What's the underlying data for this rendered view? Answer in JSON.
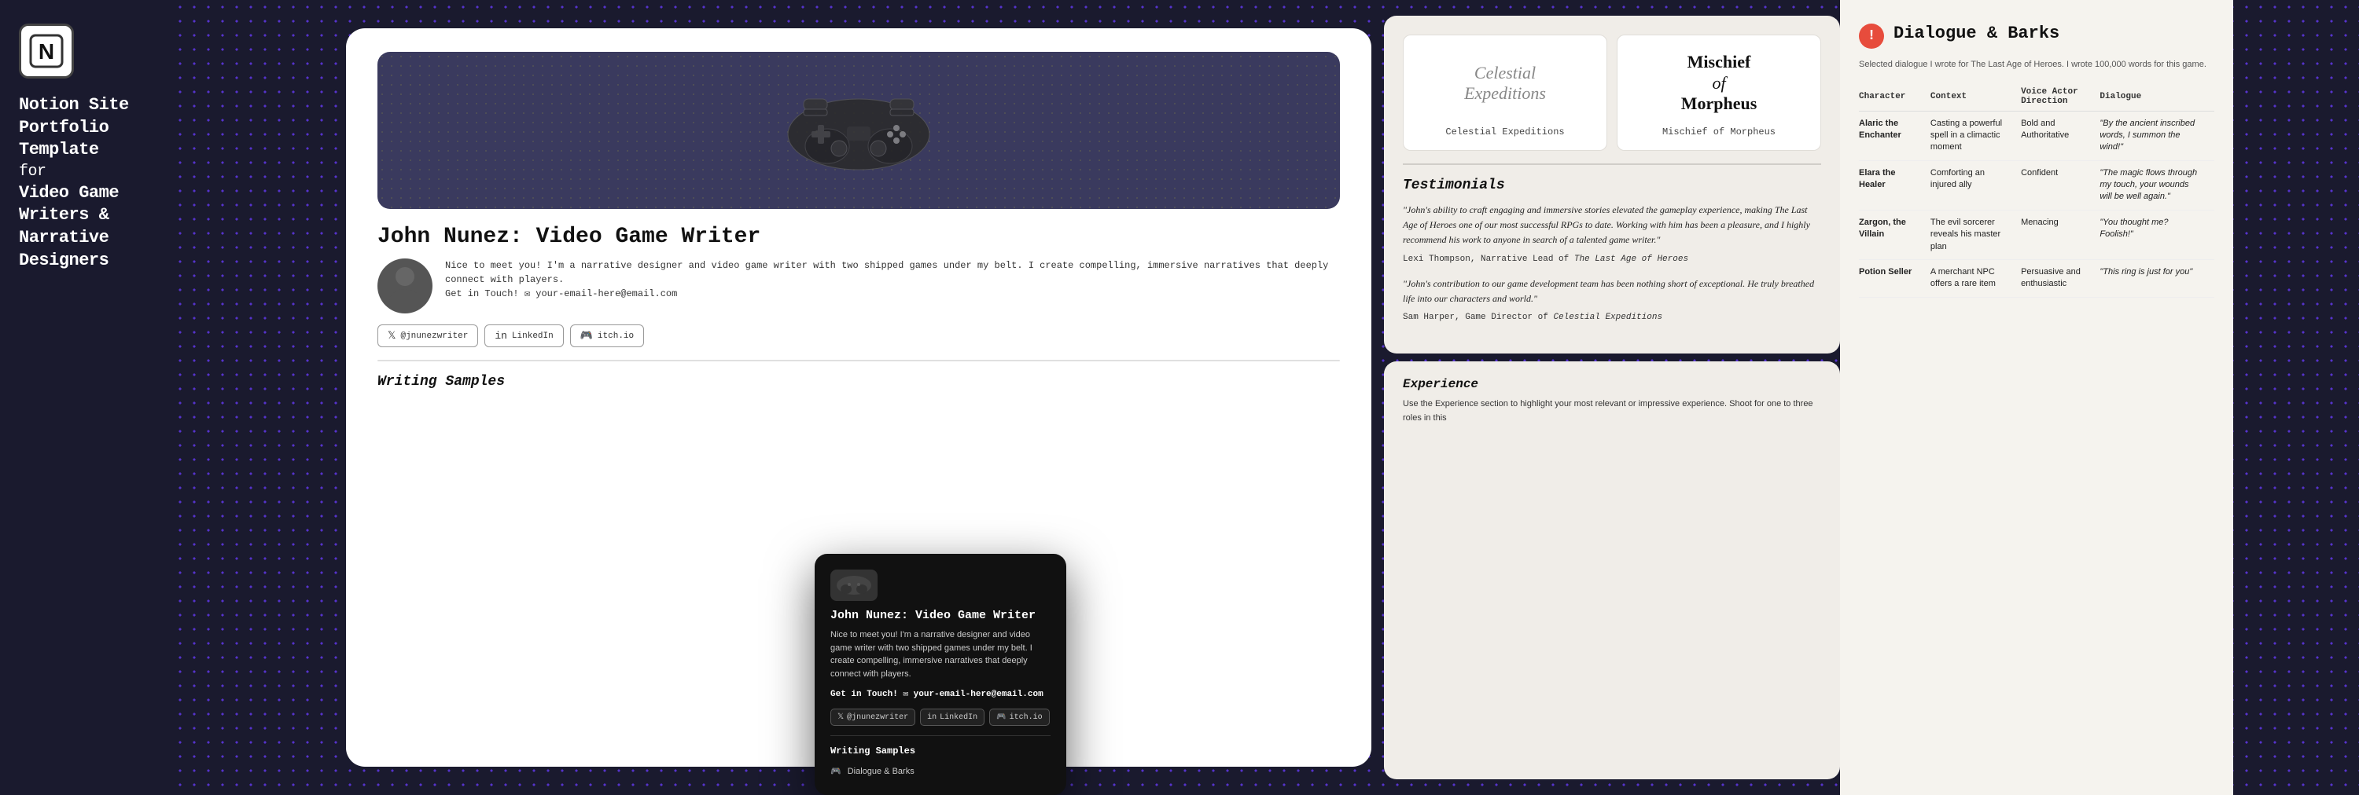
{
  "sidebar": {
    "logo_text": "N",
    "title_line1": "Notion Site",
    "title_line2": "Portfolio",
    "title_line3": "Template",
    "for_text": "for",
    "subtitle_line1": "Video Game",
    "subtitle_line2": "Writers &",
    "subtitle_line3": "Narrative",
    "subtitle_line4": "Designers"
  },
  "portfolio": {
    "card_title": "John Nunez: Video Game Writer",
    "author_description": "Nice to meet you! I'm a narrative designer and video game writer with two shipped games under my belt. I create compelling, immersive narratives that deeply connect with players.",
    "get_in_touch": "Get in Touch!",
    "email": "your-email-here@email.com",
    "social": {
      "twitter": "@jnunezwriter",
      "linkedin": "LinkedIn",
      "itchio": "itch.io"
    },
    "writing_samples_label": "Writing Samples"
  },
  "dark_popup": {
    "title": "John Nunez: Video Game Writer",
    "description": "Nice to meet you! I'm a narrative designer and video game writer with two shipped games under my belt. I create compelling, immersive narratives that deeply connect with players.",
    "get_in_touch": "Get in Touch! ✉ your-email-here@email.com",
    "social": {
      "twitter": "@jnunezwriter",
      "linkedin": "LinkedIn",
      "itchio": "itch.io"
    },
    "writing_samples_label": "Writing Samples",
    "writing_item1": "Dialogue & Barks"
  },
  "games": {
    "celestial_name": "Celestial Expeditions",
    "celestial_logo_line1": "Celestial",
    "celestial_logo_line2": "Expeditions",
    "mischief_name": "Mischief of Morpheus",
    "mischief_logo_line1": "Mischief",
    "mischief_logo_line2": "of",
    "mischief_logo_line3": "Morpheus"
  },
  "testimonials": {
    "title": "Testimonials",
    "testimonial1": {
      "quote": "\"John's ability to craft engaging and immersive stories elevated the gameplay experience, making The Last Age of Heroes one of our most successful RPGs to date. Working with him has been a pleasure, and I highly recommend his work to anyone in search of a talented game writer.\"",
      "author": "Lexi Thompson, Narrative Lead of ",
      "game": "The Last Age of Heroes"
    },
    "testimonial2": {
      "quote": "\"John's contribution to our game development team has been nothing short of exceptional. He truly breathed life into our characters and world.\"",
      "author": "Sam Harper, Game Director of ",
      "game": "Celestial Expeditions"
    }
  },
  "experience": {
    "title": "Experience",
    "description": "Use the Experience section to highlight your most relevant or impressive experience. Shoot for one to three roles in this"
  },
  "dialogue": {
    "title": "Dialogue & Barks",
    "description": "Selected dialogue I wrote for The Last Age of Heroes. I wrote 100,000 words for this game.",
    "columns": {
      "character": "Character",
      "context": "Context",
      "voice_actor": "Voice Actor Direction",
      "dialogue": "Dialogue"
    },
    "rows": [
      {
        "character": "Alaric the Enchanter",
        "context": "Casting a powerful spell in a climactic moment",
        "voice_actor": "Bold and Authoritative",
        "dialogue": "\"By the ancient inscribed words, I summon the wind!\""
      },
      {
        "character": "Elara the Healer",
        "context": "Comforting an injured ally",
        "voice_actor": "Confident",
        "dialogue": "\"The magic flows through my touch, your wounds will be well again.\""
      },
      {
        "character": "Zargon, the Villain",
        "context": "The evil sorcerer reveals his master plan",
        "voice_actor": "Menacing",
        "dialogue": "\"You thought me? Foolish!\""
      },
      {
        "character": "Potion Seller",
        "context": "A merchant NPC offers a rare item",
        "voice_actor": "Persuasive and enthusiastic",
        "dialogue": "\"This ring is just for you\""
      }
    ]
  }
}
